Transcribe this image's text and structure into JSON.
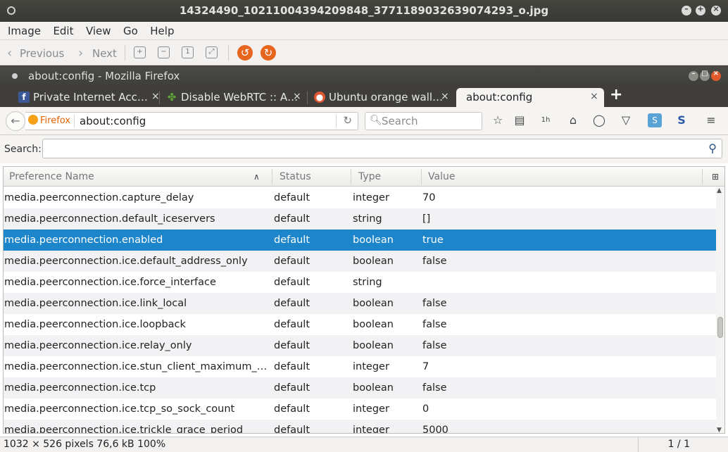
{
  "viewer": {
    "title": "14324490_10211004394209848_3771189032639074293_o.jpg",
    "menu": [
      "Image",
      "Edit",
      "View",
      "Go",
      "Help"
    ],
    "toolbar": {
      "previous_label": "Previous",
      "next_label": "Next"
    },
    "status": {
      "info": "1032 × 526 pixels  76,6 kB   100%",
      "page": "1 / 1"
    }
  },
  "firefox": {
    "title": "about:config - Mozilla Firefox",
    "tabs": [
      {
        "label": "Private Internet Acc…",
        "favicon": "facebook-icon",
        "color": "#3b5998"
      },
      {
        "label": "Disable WebRTC :: A…",
        "favicon": "puzzle-icon",
        "color": "#5fa13b"
      },
      {
        "label": "Ubuntu orange wall…",
        "favicon": "duckduckgo-icon",
        "color": "#de5833"
      },
      {
        "label": "about:config",
        "favicon": "",
        "active": true
      }
    ],
    "urlbar": {
      "identity": "Firefox",
      "url": "about:config"
    },
    "searchbar": {
      "placeholder": "Search"
    },
    "toolbar_badge": "1h"
  },
  "config": {
    "search_label": "Search:",
    "search_value": "",
    "columns": {
      "name": "Preference Name",
      "status": "Status",
      "type": "Type",
      "value": "Value"
    },
    "selected_index": 2,
    "rows": [
      {
        "name": "media.peerconnection.capture_delay",
        "status": "default",
        "type": "integer",
        "value": "70"
      },
      {
        "name": "media.peerconnection.default_iceservers",
        "status": "default",
        "type": "string",
        "value": "[]"
      },
      {
        "name": "media.peerconnection.enabled",
        "status": "default",
        "type": "boolean",
        "value": "true"
      },
      {
        "name": "media.peerconnection.ice.default_address_only",
        "status": "default",
        "type": "boolean",
        "value": "false"
      },
      {
        "name": "media.peerconnection.ice.force_interface",
        "status": "default",
        "type": "string",
        "value": ""
      },
      {
        "name": "media.peerconnection.ice.link_local",
        "status": "default",
        "type": "boolean",
        "value": "false"
      },
      {
        "name": "media.peerconnection.ice.loopback",
        "status": "default",
        "type": "boolean",
        "value": "false"
      },
      {
        "name": "media.peerconnection.ice.relay_only",
        "status": "default",
        "type": "boolean",
        "value": "false"
      },
      {
        "name": "media.peerconnection.ice.stun_client_maximum_tra…",
        "status": "default",
        "type": "integer",
        "value": "7"
      },
      {
        "name": "media.peerconnection.ice.tcp",
        "status": "default",
        "type": "boolean",
        "value": "false"
      },
      {
        "name": "media.peerconnection.ice.tcp_so_sock_count",
        "status": "default",
        "type": "integer",
        "value": "0"
      },
      {
        "name": "media.peerconnection.ice.trickle_grace_period",
        "status": "default",
        "type": "integer",
        "value": "5000"
      }
    ]
  },
  "colors": {
    "selection": "#1d85c9",
    "ubuntu_accent": "#e15a2b",
    "rotate_orange": "#e8651e"
  }
}
